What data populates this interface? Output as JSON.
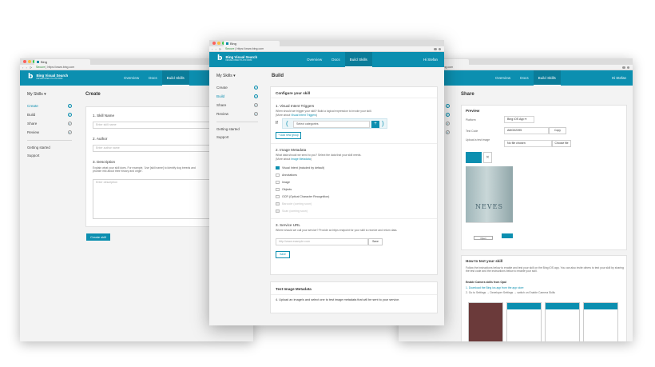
{
  "brand": {
    "name": "Bing Visual Search",
    "sub": "DEVELOPER PLATFORM",
    "logo": "b",
    "accent": "#0c8fb0"
  },
  "nav": [
    "Overview",
    "Docs",
    "Build Skills"
  ],
  "user": "Hi Stefan",
  "tab_title": "Bing",
  "url": {
    "secure": "Secure",
    "host": "https://www.bing.com"
  },
  "sidebar": {
    "title": "My Skills",
    "items": [
      "Create",
      "Build",
      "Share",
      "Review"
    ],
    "links": [
      "Getting started",
      "Support"
    ]
  },
  "left": {
    "title": "Create",
    "skill_name_label": "1. Skill Name",
    "skill_name_placeholder": "Enter skill name",
    "author_label": "2. Author",
    "author_placeholder": "Enter author name",
    "desc_label": "3. Description",
    "desc_hint": "Explain what your skill does. For example, 'Use [skill name] to identify dog breeds and provide info about their history and origin'.",
    "desc_placeholder": "Enter description",
    "create_button": "Create skill"
  },
  "center": {
    "title": "Build",
    "configure": "Configure your skill",
    "trigger_label": "1. Visual Intent Triggers",
    "trigger_hint": "When should we trigger your skill? Build a logical expression to invoke your skill.",
    "trigger_more": "(More about ",
    "trigger_link": "Visual Intent Triggers",
    "trigger_more_end": ")",
    "select_placeholder": "Select categories",
    "add_group": "+ Add new group",
    "metadata_label": "2. Image Metadata",
    "metadata_hint": "What data should we send to you? Select the data that your skill needs.",
    "metadata_more": "(More about ",
    "metadata_link": "Image Metadata",
    "metadata_more_end": ")",
    "options": [
      {
        "label": "Visual Intent (included by default)",
        "state": "on"
      },
      {
        "label": "Annotations",
        "state": "off"
      },
      {
        "label": "Image",
        "state": "off"
      },
      {
        "label": "Objects",
        "state": "off"
      },
      {
        "label": "OCR (Optical Character Recognition)",
        "state": "off"
      },
      {
        "label": "Barcode (coming soon)",
        "state": "disabled"
      },
      {
        "label": "Scan (coming soon)",
        "state": "disabled"
      }
    ],
    "service_label": "3. Service URL",
    "service_hint": "Where should we call your service? Provide an https endpoint for your skill to receive and return data.",
    "service_placeholder": "http://www.example.com",
    "service_save": "Save",
    "save_button": "Save",
    "test_title": "Test Image Metadata",
    "test_step": "4. Upload an image/s and select one to test image metadata that will be sent to your service."
  },
  "right": {
    "title": "Share",
    "preview": "Preview",
    "platform_label": "Platform",
    "platform_value": "Bing iOS App",
    "test_code_label": "Test Code",
    "test_code_value": "AMG02395",
    "copy": "Copy",
    "upload_label": "Upload a test image",
    "no_file": "No file chosen",
    "choose_file": "Choose file",
    "how_title": "How to test your skill",
    "how_text": "Follow the instructions below to enable and test your skill on the Bing iOS app. You can also invite others to test your skill by sharing the test code and the instructions below to enable your skill.",
    "enable_title": "Enable Camera skills from Opal",
    "steps": [
      "1. Download the Bing ios app from the app store",
      "2. Go to Settings → Developer Settings → switch on Enable Camera Skills"
    ],
    "bottle_text": "NEVES",
    "phone_btn": "Open"
  }
}
